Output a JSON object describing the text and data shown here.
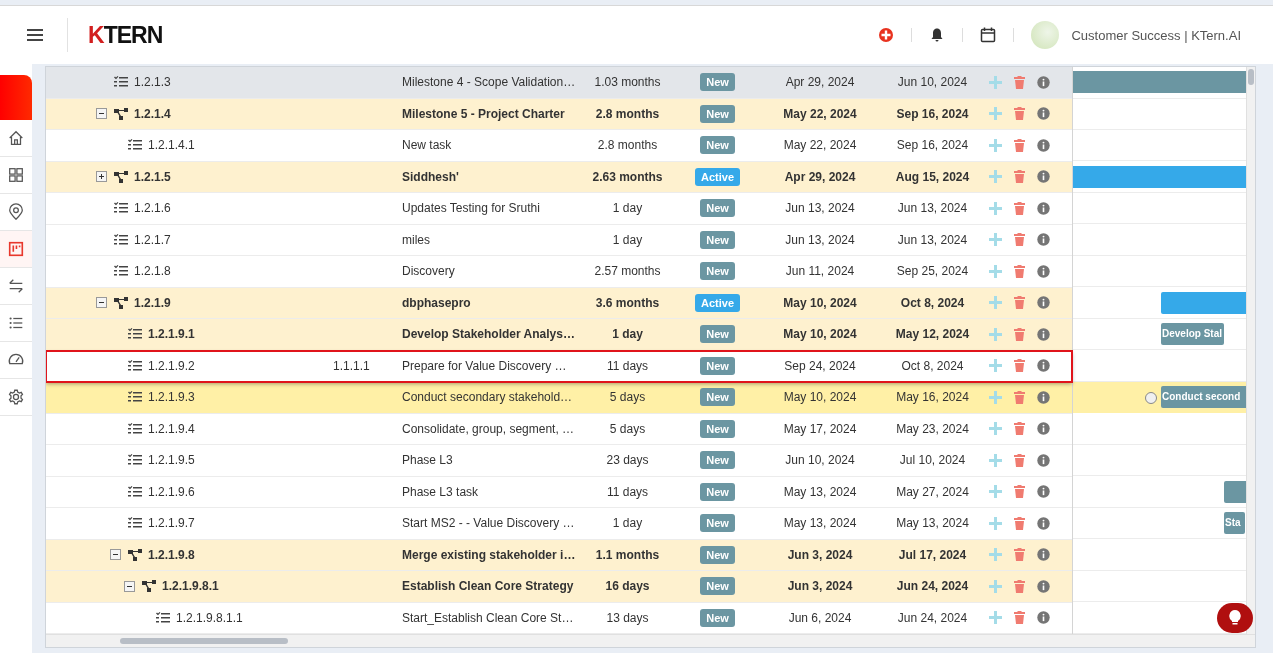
{
  "header": {
    "logo": "KTERN",
    "user": "Customer Success | KTern.AI"
  },
  "sidebar": {
    "items": [
      {
        "selected": false
      },
      {
        "selected": false
      },
      {
        "selected": false
      },
      {
        "selected": true
      },
      {
        "selected": false
      },
      {
        "selected": false
      },
      {
        "selected": false
      },
      {
        "selected": false
      }
    ]
  },
  "rows": [
    {
      "id": "1.2.1.3",
      "kind": "task",
      "name": "Milestone 4 - Scope Validation…",
      "duration": "1.03 months",
      "status": "New",
      "color": "#6b96a2",
      "start": "Apr 29, 2024",
      "end": "Jun 10, 2024",
      "selected": true,
      "hovered": false,
      "outlined": false
    },
    {
      "id": "1.2.1.4",
      "kind": "group",
      "expanded": true,
      "name": "Milestone 5 - Project Charter",
      "duration": "2.8 months",
      "status": "New",
      "color": "#6b96a2",
      "start": "May 22, 2024",
      "end": "Sep 16, 2024",
      "selected": false,
      "hovered": false,
      "outlined": false,
      "children": [
        {
          "id": "1.2.1.4.1",
          "kind": "task",
          "name": "New task",
          "duration": "2.8 months",
          "status": "New",
          "color": "#6b96a2",
          "start": "May 22, 2024",
          "end": "Sep 16, 2024",
          "selected": false,
          "hovered": false,
          "outlined": false
        }
      ]
    },
    {
      "id": "1.2.1.5",
      "kind": "group",
      "expanded": false,
      "name": "Siddhesh'",
      "duration": "2.63 months",
      "status": "Active",
      "color": "#35a9e9",
      "start": "Apr 29, 2024",
      "end": "Aug 15, 2024",
      "selected": false,
      "hovered": false,
      "outlined": false
    },
    {
      "id": "1.2.1.6",
      "kind": "task",
      "name": "Updates Testing for Sruthi",
      "duration": "1 day",
      "status": "New",
      "color": "#6b96a2",
      "start": "Jun 13, 2024",
      "end": "Jun 13, 2024",
      "selected": false,
      "hovered": false,
      "outlined": false
    },
    {
      "id": "1.2.1.7",
      "kind": "task",
      "name": "miles",
      "duration": "1 day",
      "status": "New",
      "color": "#6b96a2",
      "start": "Jun 13, 2024",
      "end": "Jun 13, 2024",
      "selected": false,
      "hovered": false,
      "outlined": false
    },
    {
      "id": "1.2.1.8",
      "kind": "task",
      "name": "Discovery",
      "duration": "2.57 months",
      "status": "New",
      "color": "#6b96a2",
      "start": "Jun 11, 2024",
      "end": "Sep 25, 2024",
      "selected": false,
      "hovered": false,
      "outlined": false
    },
    {
      "id": "1.2.1.9",
      "kind": "group",
      "expanded": true,
      "name": "dbphasepro",
      "duration": "3.6 months",
      "status": "Active",
      "color": "#35a9e9",
      "start": "May 10, 2024",
      "end": "Oct 8, 2024",
      "selected": false,
      "hovered": false,
      "outlined": false,
      "children": [
        {
          "id": "1.2.1.9.1",
          "kind": "summary",
          "name": "Develop Stakeholder Analys…",
          "duration": "1 day",
          "status": "New",
          "color": "#6b96a2",
          "start": "May 10, 2024",
          "end": "May 12, 2024",
          "bar_label": "Develop Stal",
          "selected": false,
          "hovered": false,
          "outlined": false
        },
        {
          "id": "1.2.1.9.2",
          "kind": "task",
          "column_2": "1.1.1.1",
          "name": "Prepare for Value Discovery …",
          "duration": "11 days",
          "status": "New",
          "color": "#6b96a2",
          "start": "Sep 24, 2024",
          "end": "Oct 8, 2024",
          "selected": false,
          "hovered": false,
          "outlined": true
        },
        {
          "id": "1.2.1.9.3",
          "kind": "task",
          "name": "Conduct secondary stakehold…",
          "duration": "5 days",
          "status": "New",
          "color": "#6b96a2",
          "start": "May 10, 2024",
          "end": "May 16, 2024",
          "bar_label": "Conduct second",
          "selected": false,
          "hovered": true,
          "outlined": false
        },
        {
          "id": "1.2.1.9.4",
          "kind": "task",
          "name": "Consolidate, group, segment, …",
          "duration": "5 days",
          "status": "New",
          "color": "#6b96a2",
          "start": "May 17, 2024",
          "end": "May 23, 2024",
          "selected": false,
          "hovered": false,
          "outlined": false
        },
        {
          "id": "1.2.1.9.5",
          "kind": "task",
          "name": "Phase L3",
          "duration": "23 days",
          "status": "New",
          "color": "#6b96a2",
          "start": "Jun 10, 2024",
          "end": "Jul 10, 2024",
          "selected": false,
          "hovered": false,
          "outlined": false
        },
        {
          "id": "1.2.1.9.6",
          "kind": "task",
          "name": "Phase L3 task",
          "duration": "11 days",
          "status": "New",
          "color": "#6b96a2",
          "start": "May 13, 2024",
          "end": "May 27, 2024",
          "selected": false,
          "hovered": false,
          "outlined": false
        },
        {
          "id": "1.2.1.9.7",
          "kind": "task",
          "name": "Start MS2 - - Value Discovery …",
          "duration": "1 day",
          "status": "New",
          "color": "#6b96a2",
          "start": "May 13, 2024",
          "end": "May 13, 2024",
          "bar_label": "Sta",
          "selected": false,
          "hovered": false,
          "outlined": false
        },
        {
          "id": "1.2.1.9.8",
          "kind": "group",
          "expanded": true,
          "name": "Merge existing stakeholder i…",
          "duration": "1.1 months",
          "status": "New",
          "color": "#6b96a2",
          "start": "Jun 3, 2024",
          "end": "Jul 17, 2024",
          "selected": false,
          "hovered": false,
          "outlined": false,
          "children": [
            {
              "id": "1.2.1.9.8.1",
              "kind": "group",
              "expanded": true,
              "name": "Establish Clean Core Strategy",
              "duration": "16 days",
              "status": "New",
              "color": "#6b96a2",
              "start": "Jun 3, 2024",
              "end": "Jun 24, 2024",
              "selected": false,
              "hovered": false,
              "outlined": false,
              "children": [
                {
                  "id": "1.2.1.9.8.1.1",
                  "kind": "task",
                  "name": "Start_Establish Clean Core St…",
                  "duration": "13 days",
                  "status": "New",
                  "color": "#6b96a2",
                  "start": "Jun 6, 2024",
                  "end": "Jun 24, 2024",
                  "selected": false,
                  "hovered": false,
                  "outlined": false
                }
              ]
            }
          ]
        }
      ]
    }
  ]
}
